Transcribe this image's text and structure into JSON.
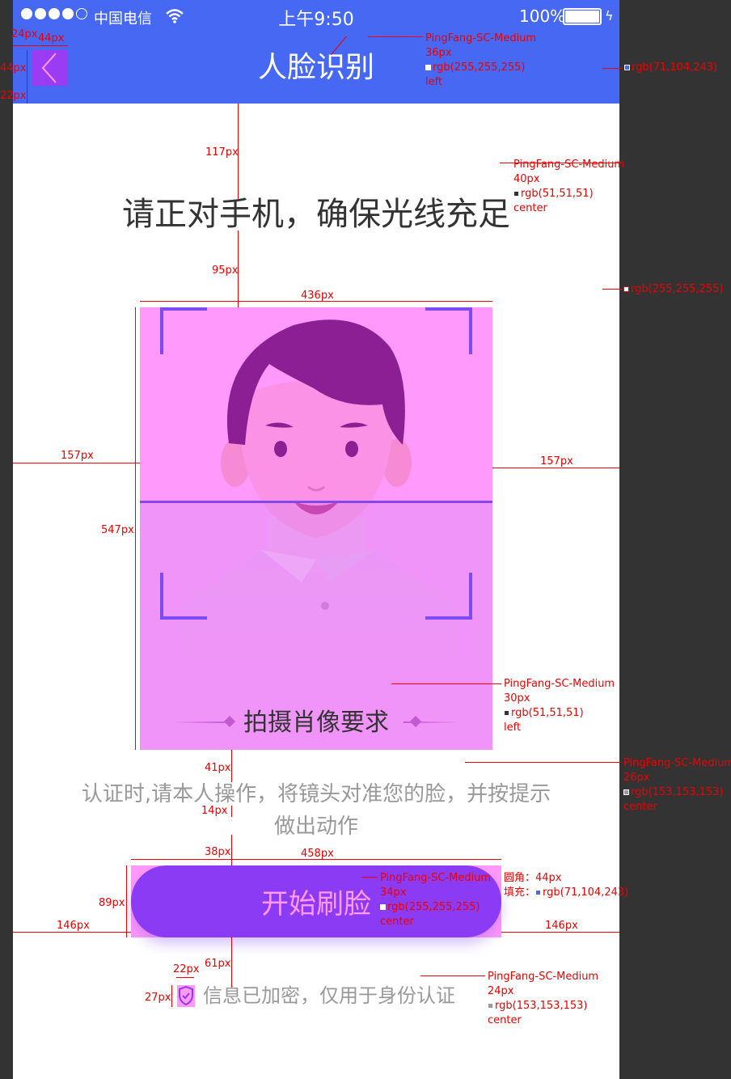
{
  "status_bar": {
    "carrier": "中国电信",
    "time": "上午9:50",
    "battery": "100%",
    "signal_bars": 4
  },
  "nav": {
    "title": "人脸识别",
    "back_icon": "chevron-left-icon"
  },
  "instruction": "请正对手机，确保光线充足",
  "capture": {
    "requirement_label": "拍摄肖像要求"
  },
  "hint": "认证时,请本人操作，将镜头对准您的脸，并按提示做出动作",
  "start_button": "开始刷脸",
  "secure_note": "信息已加密，仅用于身份认证",
  "colors": {
    "primary": "#4768f3",
    "title_text": "#333333",
    "hint_text": "#999999",
    "button_text": "#ffffff",
    "page_bg": "#ffffff"
  },
  "annotations": {
    "nav_title": [
      "PingFang-SC-Medium",
      "36px",
      "rgb(255,255,255)",
      "left"
    ],
    "nav_bg": "rgb(71,104,243)",
    "page_bg": "rgb(255,255,255)",
    "instruction": [
      "PingFang-SC-Medium",
      "40px",
      "rgb(51,51,51)",
      "center"
    ],
    "requirement": [
      "PingFang-SC-Medium",
      "30px",
      "rgb(51,51,51)",
      "left"
    ],
    "hint": [
      "PingFang-SC-Medium",
      "26px",
      "rgb(153,153,153)",
      "center"
    ],
    "button_text": [
      "PingFang-SC-Medium",
      "34px",
      "rgb(255,255,255)",
      "center"
    ],
    "button_style": [
      "圆角：44px",
      "填充：",
      "rgb(71,104,243)"
    ],
    "secure_text": [
      "PingFang-SC-Medium",
      "24px",
      "rgb(153,153,153)",
      "center"
    ],
    "dims": {
      "d24": "24px",
      "d44w": "44px",
      "d44h": "44px",
      "d22": "22px",
      "d117": "117px",
      "d95": "95px",
      "d436": "436px",
      "d547": "547px",
      "d157l": "157px",
      "d157r": "157px",
      "d41": "41px",
      "d14": "14px",
      "d38": "38px",
      "d458": "458px",
      "d89": "89px",
      "d146l": "146px",
      "d146r": "146px",
      "d61": "61px",
      "d22i": "22px",
      "d27": "27px"
    }
  }
}
